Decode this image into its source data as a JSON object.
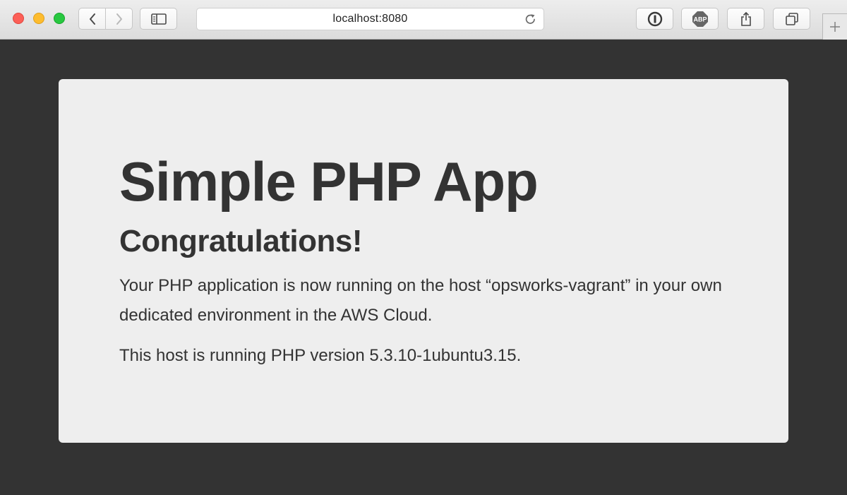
{
  "browser": {
    "address": "localhost:8080",
    "toolbar_icons": [
      "back-icon",
      "forward-icon",
      "sidebar-icon",
      "reload-icon",
      "1password-icon",
      "adblock-icon",
      "share-icon",
      "tabs-overview-icon",
      "new-tab-icon"
    ],
    "adblock_label": "ABP",
    "traffic_colors": {
      "close": "#fc5f57",
      "minimize": "#fdbc2e",
      "maximize": "#28c840"
    }
  },
  "page": {
    "title": "Simple PHP App",
    "heading": "Congratulations!",
    "paragraph_1": "Your PHP application is now running on the host “opsworks-vagrant” in your own dedicated environment in the AWS Cloud.",
    "paragraph_2": "This host is running PHP version 5.3.10-1ubuntu3.15.",
    "background_color": "#333333",
    "card_color": "#eeeeee",
    "text_color": "#333333"
  }
}
